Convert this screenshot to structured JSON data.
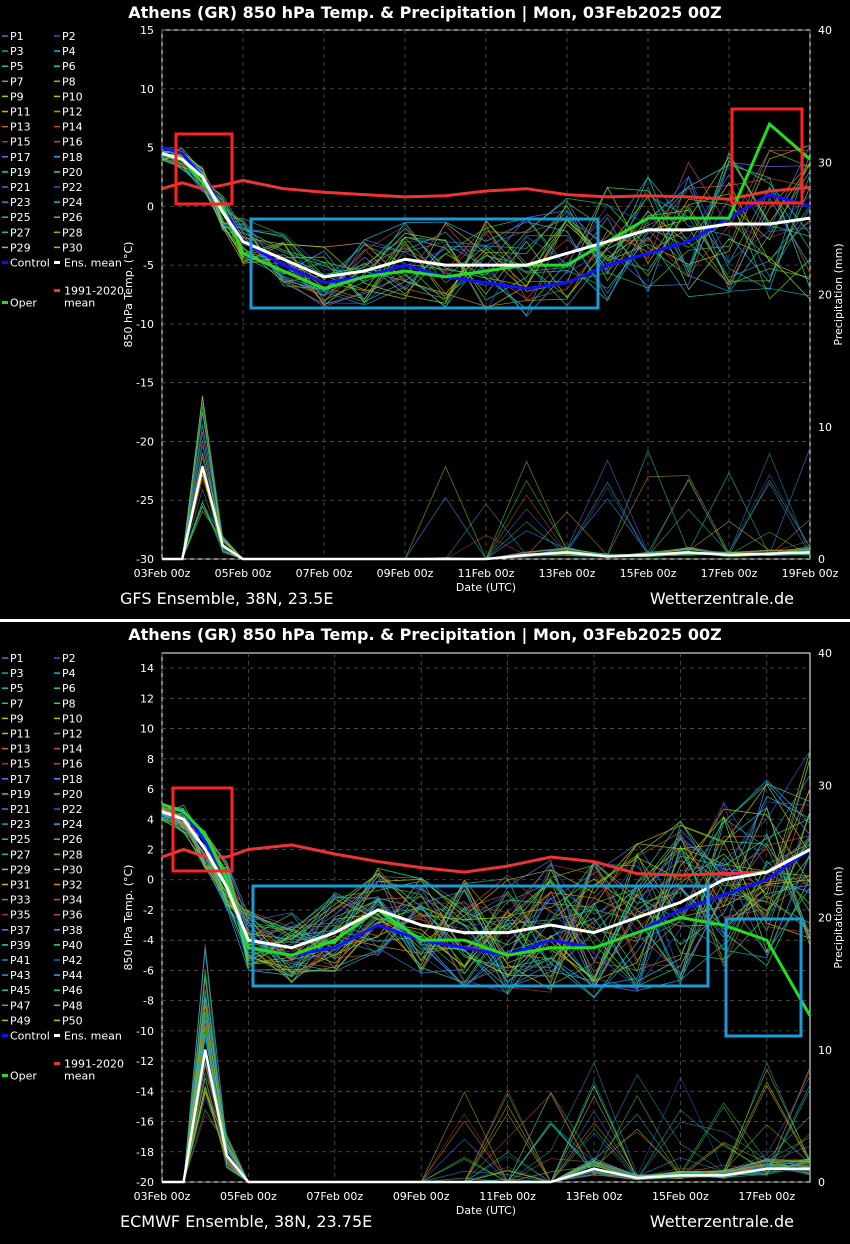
{
  "colors": {
    "plum": "#8040c0",
    "mean_line": "#ffffff",
    "control": "#1010ff",
    "oper": "#22dd22",
    "clim": "#ee3333",
    "box_red": "#ff2222",
    "box_blue": "#1a9ad6"
  },
  "panels": [
    {
      "title": "Athens  (GR)  850 hPa Temp. & Precipitation | Mon, 03Feb2025 00Z",
      "footer_left": "GFS Ensemble, 38N, 23.5E",
      "footer_right": "Wetterzentrale.de",
      "members": [
        "P1",
        "P2",
        "P3",
        "P4",
        "P5",
        "P6",
        "P7",
        "P8",
        "P9",
        "P10",
        "P11",
        "P12",
        "P13",
        "P14",
        "P15",
        "P16",
        "P17",
        "P18",
        "P19",
        "P20",
        "P21",
        "P22",
        "P23",
        "P24",
        "P25",
        "P26",
        "P27",
        "P28",
        "P29",
        "P30"
      ],
      "legend_extra": {
        "control": "Control",
        "ens_mean": "Ens. mean",
        "oper": "Oper",
        "clim": "1991-2020\nmean"
      },
      "chart_data": {
        "type": "line",
        "title": "Athens  (GR)  850 hPa Temp. & Precipitation | Mon, 03Feb2025 00Z",
        "xlabel": "Date (UTC)",
        "ylabel": "850 hPa Temp. (°C)",
        "y2label": "Precipitation (mm)",
        "xlim": [
          0,
          16
        ],
        "ylim": [
          -30,
          15
        ],
        "y2lim": [
          0,
          40
        ],
        "yticks": [
          -30,
          -25,
          -20,
          -15,
          -10,
          -5,
          0,
          5,
          10,
          15
        ],
        "y2ticks": [
          0,
          10,
          20,
          30,
          40
        ],
        "xticks": [
          "03Feb 00z",
          "05Feb 00z",
          "07Feb 00z",
          "09Feb 00z",
          "11Feb 00z",
          "13Feb 00z",
          "15Feb 00z",
          "17Feb 00z",
          "19Feb 00z"
        ],
        "grid": true,
        "x_days": [
          0,
          0.5,
          1,
          1.5,
          2,
          3,
          4,
          5,
          6,
          7,
          8,
          9,
          10,
          11,
          12,
          13,
          14,
          15,
          16
        ],
        "series": [
          {
            "name": "Ens. mean",
            "values": [
              4.5,
              4,
              2.5,
              -0.5,
              -3,
              -4.5,
              -6,
              -5.5,
              -4.5,
              -5,
              -5,
              -5,
              -4,
              -3,
              -2,
              -2,
              -1.5,
              -1.5,
              -1
            ]
          },
          {
            "name": "Control",
            "values": [
              5,
              4.5,
              2.5,
              0,
              -3,
              -5,
              -6.5,
              -6,
              -5,
              -6,
              -6.5,
              -7,
              -6.5,
              -5,
              -4,
              -3,
              -1,
              1,
              0
            ]
          },
          {
            "name": "Oper",
            "values": [
              4.5,
              4,
              2,
              0,
              -4,
              -5.5,
              -7,
              -6,
              -5.5,
              -6,
              -5.5,
              -5,
              -5,
              -3,
              -1,
              -1,
              -1,
              7,
              4
            ]
          },
          {
            "name": "1991-2020 mean",
            "values": [
              1.5,
              2,
              1.5,
              1.8,
              2.2,
              1.5,
              1.2,
              1,
              0.8,
              0.9,
              1.3,
              1.5,
              1,
              0.8,
              0.9,
              0.8,
              0.6,
              1.3,
              1.6
            ]
          }
        ],
        "precip_mean": [
          0,
          0,
          7,
          1,
          0,
          0,
          0,
          0,
          0,
          0,
          0,
          0.3,
          0.5,
          0.2,
          0.3,
          0.5,
          0.3,
          0.4,
          0.5
        ],
        "annotations": [
          "red box 03-05Feb",
          "blue box 05Feb-14Feb",
          "red box 17-19Feb"
        ]
      }
    },
    {
      "title": "Athens  (GR)  850 hPa Temp. & Precipitation | Mon, 03Feb2025 00Z",
      "footer_left": "ECMWF Ensemble, 38N, 23.75E",
      "footer_right": "Wetterzentrale.de",
      "members": [
        "P1",
        "P2",
        "P3",
        "P4",
        "P5",
        "P6",
        "P7",
        "P8",
        "P9",
        "P10",
        "P11",
        "P12",
        "P13",
        "P14",
        "P15",
        "P16",
        "P17",
        "P18",
        "P19",
        "P20",
        "P21",
        "P22",
        "P23",
        "P24",
        "P25",
        "P26",
        "P27",
        "P28",
        "P29",
        "P30",
        "P31",
        "P32",
        "P33",
        "P34",
        "P35",
        "P36",
        "P37",
        "P38",
        "P39",
        "P40",
        "P41",
        "P42",
        "P43",
        "P44",
        "P45",
        "P46",
        "P47",
        "P48",
        "P49",
        "P50"
      ],
      "legend_extra": {
        "control": "Control",
        "ens_mean": "Ens. mean",
        "oper": "Oper",
        "clim": "1991-2020\nmean"
      },
      "chart_data": {
        "type": "line",
        "title": "Athens  (GR)  850 hPa Temp. & Precipitation | Mon, 03Feb2025 00Z",
        "xlabel": "Date (UTC)",
        "ylabel": "850 hPa Temp. (°C)",
        "y2label": "Precipitation (mm)",
        "xlim": [
          0,
          15
        ],
        "ylim": [
          -20,
          15
        ],
        "y2lim": [
          0,
          40
        ],
        "yticks": [
          -20,
          -18,
          -16,
          -14,
          -12,
          -10,
          -8,
          -6,
          -4,
          -2,
          0,
          2,
          4,
          6,
          8,
          10,
          12,
          14
        ],
        "y2ticks": [
          0,
          10,
          20,
          30,
          40
        ],
        "xticks": [
          "03Feb 00z",
          "05Feb 00z",
          "07Feb 00z",
          "09Feb 00z",
          "11Feb 00z",
          "13Feb 00z",
          "15Feb 00z",
          "17Feb 00z"
        ],
        "grid": true,
        "x_days": [
          0,
          0.5,
          1,
          1.5,
          2,
          3,
          4,
          5,
          6,
          7,
          8,
          9,
          10,
          11,
          12,
          13,
          14,
          15
        ],
        "series": [
          {
            "name": "Ens. mean",
            "values": [
              4.5,
              4,
              2,
              -0.5,
              -4,
              -4.5,
              -3.5,
              -2,
              -3,
              -3.5,
              -3.5,
              -3,
              -3.5,
              -2.5,
              -1.5,
              0,
              0.5,
              2
            ]
          },
          {
            "name": "Control",
            "values": [
              5,
              4.5,
              2.5,
              0,
              -4.5,
              -5,
              -4.5,
              -3,
              -4,
              -4.5,
              -5,
              -4,
              -4.5,
              -3.5,
              -2,
              -1,
              0,
              2
            ]
          },
          {
            "name": "Oper",
            "values": [
              5,
              4.5,
              3,
              0,
              -4.5,
              -5,
              -4,
              -2,
              -4,
              -4,
              -5,
              -4.5,
              -4.5,
              -3.5,
              -2.5,
              -3,
              -4,
              -9
            ]
          },
          {
            "name": "1991-2020 mean",
            "values": [
              1.5,
              2,
              1.5,
              1.5,
              2,
              2.3,
              1.7,
              1.2,
              0.8,
              0.5,
              0.9,
              1.5,
              1.2,
              0.4,
              0.3,
              0.4,
              0.5,
              2
            ]
          }
        ],
        "precip_mean": [
          0,
          0,
          10,
          2,
          0,
          0,
          0,
          0,
          0,
          0,
          0,
          0,
          1,
          0.3,
          0.5,
          0.5,
          1,
          1
        ],
        "annotations": [
          "red box 03-05Feb",
          "blue box 05Feb-15Feb",
          "blue box 16-18Feb"
        ]
      }
    }
  ]
}
